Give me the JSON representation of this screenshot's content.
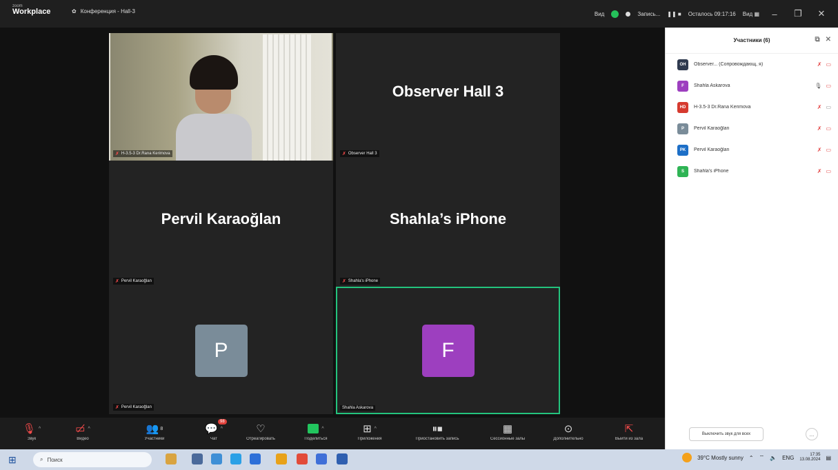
{
  "titlebar": {
    "brand_small": "zoom",
    "brand_big": "Workplace",
    "meeting_title": "Конференция - Hall-3",
    "view_label": "Вид",
    "record_label": "Запись...",
    "time_left": "Осталось 09:17:16",
    "layout_label": "Вид"
  },
  "tiles": [
    {
      "name": "H-3.5-3 Dr.Rana Kerimova",
      "type": "camera"
    },
    {
      "name": "Observer Hall 3",
      "big": "Observer Hall 3",
      "type": "name"
    },
    {
      "name": "Pervil Karaoğlan",
      "big": "Pervil Karaoğlan",
      "type": "name"
    },
    {
      "name": "Shahla's iPhone",
      "big": "Shahla’s iPhone",
      "type": "name"
    },
    {
      "name": "Pervil Karaoğlan",
      "initial": "P",
      "color": "#7a8c99",
      "type": "avatar"
    },
    {
      "name": "Shahla Askarova",
      "initial": "F",
      "color": "#9d3fbf",
      "type": "avatar",
      "active": true
    }
  ],
  "toolbar": {
    "audio": "Звук",
    "video": "Видео",
    "participants": "Участники",
    "participants_count": "8",
    "chat": "Чат",
    "chat_badge": "98",
    "react": "Отреагировать",
    "share": "Поделиться",
    "apps": "Приложения",
    "pause_record": "Приостановить запись",
    "rooms": "Сессионные залы",
    "more": "Дополнительно",
    "leave": "Выйти из зала"
  },
  "panel": {
    "title": "Участники (6)",
    "participants": [
      {
        "initials": "OH",
        "color": "#2f3a4f",
        "name": "Observer... (Сопровождающ, я)",
        "mic": "muted",
        "cam": "off"
      },
      {
        "initials": "F",
        "color": "#9d3fbf",
        "name": "Shahla Askarova",
        "mic": "on",
        "cam": "off"
      },
      {
        "initials": "HD",
        "color": "#d63a2f",
        "name": "H-3.5-3 Dr.Rana Kerimova",
        "mic": "muted",
        "cam": "on"
      },
      {
        "initials": "P",
        "color": "#7a8c99",
        "name": "Pervil Karaoğlan",
        "mic": "muted",
        "cam": "off"
      },
      {
        "initials": "PK",
        "color": "#1d6fc7",
        "name": "Pervil Karaoğlan",
        "mic": "muted",
        "cam": "off"
      },
      {
        "initials": "S",
        "color": "#2fb455",
        "name": "Shahla's iPhone",
        "mic": "muted",
        "cam": "off"
      }
    ],
    "mute_all": "Выключить звук для всех",
    "more": "..."
  },
  "taskbar": {
    "search_placeholder": "Поиск",
    "weather": "39°C  Mostly sunny",
    "lang": "ENG",
    "time": "17:35",
    "date": "13.08.2024"
  }
}
